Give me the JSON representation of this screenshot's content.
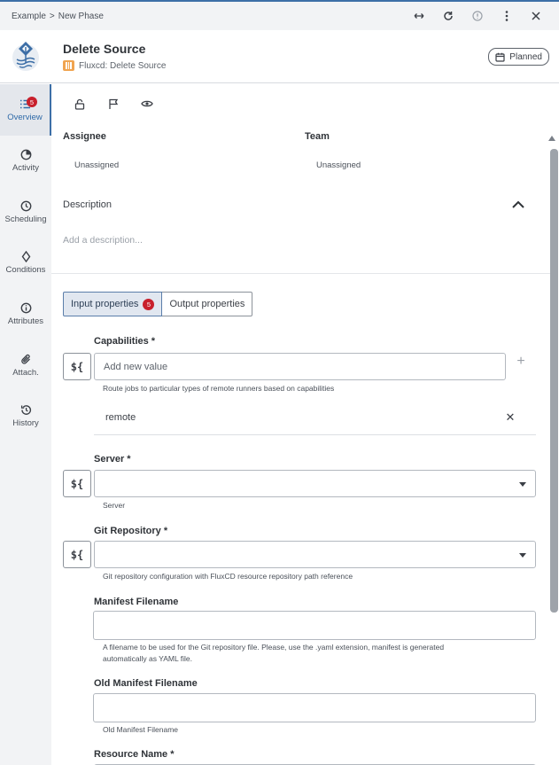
{
  "breadcrumb": {
    "root": "Example",
    "separator": ">",
    "current": "New Phase"
  },
  "topbar": {
    "icons": [
      "expand-horizontal-icon",
      "refresh-icon",
      "info-icon",
      "more-vertical-icon",
      "close-icon"
    ]
  },
  "header": {
    "title": "Delete Source",
    "subtitle": "Fluxcd: Delete Source",
    "status": "Planned",
    "accent": "#3d6fa7"
  },
  "sidebar": {
    "items": [
      {
        "label": "Overview",
        "icon": "list-icon",
        "badge": "5",
        "active": true
      },
      {
        "label": "Activity",
        "icon": "pie-clock-icon"
      },
      {
        "label": "Scheduling",
        "icon": "clock-icon"
      },
      {
        "label": "Conditions",
        "icon": "diamond-icon"
      },
      {
        "label": "Attributes",
        "icon": "info-circle-icon"
      },
      {
        "label": "Attach.",
        "icon": "paperclip-icon"
      },
      {
        "label": "History",
        "icon": "history-icon"
      }
    ]
  },
  "main": {
    "assignee": {
      "label": "Assignee",
      "value": "Unassigned"
    },
    "team": {
      "label": "Team",
      "value": "Unassigned"
    },
    "description": {
      "label": "Description",
      "placeholder": "Add a description..."
    },
    "tabs": [
      {
        "label": "Input properties",
        "badge": "5",
        "active": true
      },
      {
        "label": "Output properties"
      }
    ],
    "fields": {
      "capabilities": {
        "label": "Capabilities *",
        "placeholder": "Add new value",
        "help": "Route jobs to particular types of remote runners based on capabilities",
        "chips": [
          "remote"
        ]
      },
      "server": {
        "label": "Server *",
        "help": "Server"
      },
      "git_repository": {
        "label": "Git Repository *",
        "help": "Git repository configuration with FluxCD resource repository path reference"
      },
      "manifest_filename": {
        "label": "Manifest Filename",
        "help_line1": "A filename to be used for the Git repository file. Please, use the .yaml extension, manifest is generated",
        "help_line2": "automatically as YAML file."
      },
      "old_manifest_filename": {
        "label": "Old Manifest Filename",
        "help": "Old Manifest Filename"
      },
      "resource_name": {
        "label": "Resource Name *"
      }
    },
    "fx_label": "${"
  }
}
